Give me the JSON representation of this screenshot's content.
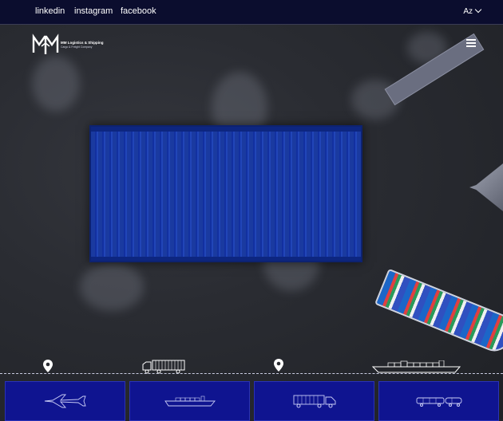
{
  "topbar": {
    "social_links": [
      "linkedin",
      "instagram",
      "facebook"
    ],
    "language": "Az"
  },
  "brand": {
    "name": "MM Logistics & Shipping",
    "tagline": "Cargo & Freight Company"
  },
  "icons": {
    "menu": "hamburger-icon",
    "pins": [
      "map-pin-icon",
      "map-pin-icon"
    ],
    "vehicles": [
      "truck-icon",
      "ship-icon"
    ],
    "cards": [
      "airplane-icon",
      "cargo-ship-icon",
      "truck-icon",
      "train-icon"
    ]
  },
  "colors": {
    "topbar": "#0b0d2e",
    "card": "#0f1490",
    "container": "#1a3aa0"
  }
}
